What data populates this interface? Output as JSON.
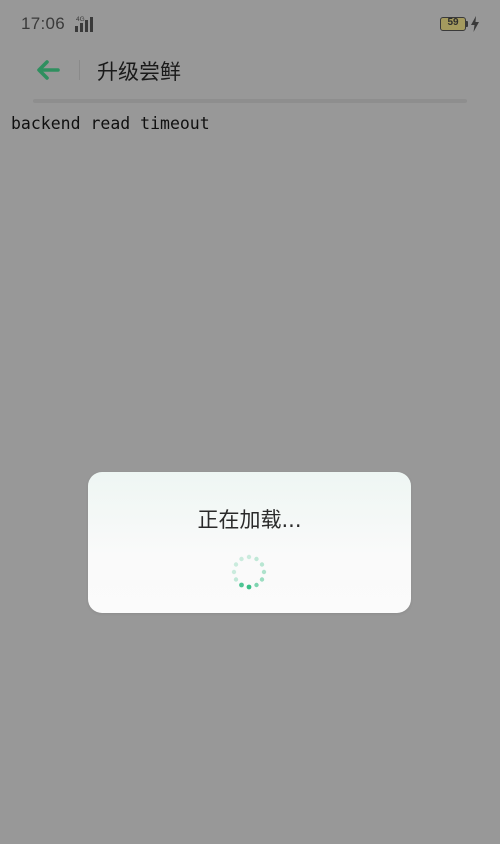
{
  "status_bar": {
    "time": "17:06",
    "network": "4G",
    "battery_level": "59",
    "icons": [
      "signal-icon",
      "battery-icon",
      "charging-bolt-icon"
    ]
  },
  "header": {
    "back_icon": "back-arrow-icon",
    "title": "升级尝鲜"
  },
  "content": {
    "message": "backend read timeout"
  },
  "loading_dialog": {
    "text": "正在加载...",
    "icon": "loading-spinner-icon"
  },
  "colors": {
    "accent": "#2f8f5f",
    "scrim": "#989898",
    "dialog_bg": "#fafafa",
    "spinner": "#3bbf88"
  }
}
